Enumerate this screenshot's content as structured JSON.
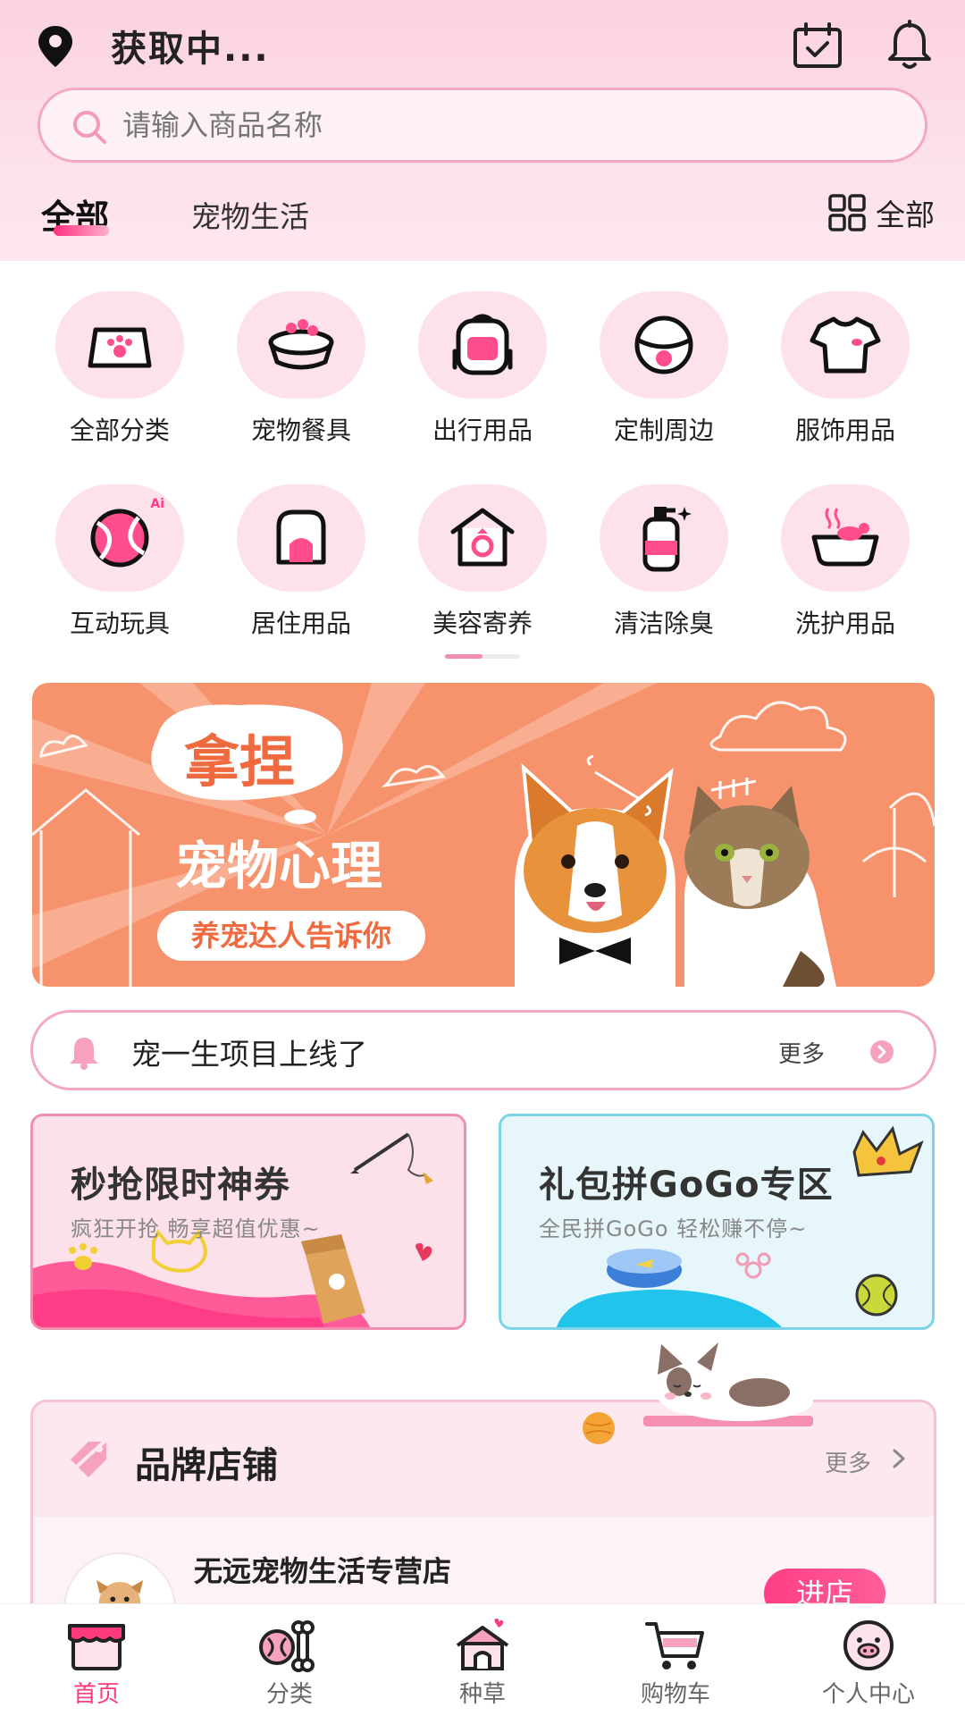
{
  "header": {
    "location": "获取中...",
    "search_placeholder": "请输入商品名称",
    "tabs": [
      "全部",
      "宠物生活"
    ],
    "all_button": "全部"
  },
  "categories": [
    {
      "label": "全部分类",
      "icon": "pet-paw-card-icon"
    },
    {
      "label": "宠物餐具",
      "icon": "pet-bowl-icon"
    },
    {
      "label": "出行用品",
      "icon": "backpack-icon"
    },
    {
      "label": "定制周边",
      "icon": "collar-bell-icon"
    },
    {
      "label": "服饰用品",
      "icon": "tshirt-icon"
    },
    {
      "label": "互动玩具",
      "icon": "ball-toy-icon",
      "badge": "Ai"
    },
    {
      "label": "居住用品",
      "icon": "pet-house-icon"
    },
    {
      "label": "美容寄养",
      "icon": "grooming-house-icon"
    },
    {
      "label": "清洁除臭",
      "icon": "spray-bottle-icon"
    },
    {
      "label": "洗护用品",
      "icon": "bathtub-icon"
    }
  ],
  "banner": {
    "headline": "拿捏",
    "title": "宠物心理",
    "subtitle": "养宠达人告诉你"
  },
  "notice": {
    "text": "宠一生项目上线了",
    "more": "更多"
  },
  "promos": [
    {
      "title": "秒抢限时神券",
      "subtitle": "疯狂开抢  畅享超值优惠~"
    },
    {
      "title": "礼包拼GoGo专区",
      "subtitle": "全民拼GoGo  轻松赚不停~"
    }
  ],
  "brand": {
    "title": "品牌店铺",
    "more": "更多",
    "shop_name": "无远宠物生活专营店",
    "enter": "进店"
  },
  "nav": [
    {
      "label": "首页",
      "active": true
    },
    {
      "label": "分类",
      "active": false
    },
    {
      "label": "种草",
      "active": false
    },
    {
      "label": "购物车",
      "active": false
    },
    {
      "label": "个人中心",
      "active": false
    }
  ],
  "colors": {
    "accent": "#ff3a7c",
    "soft_pink": "#fde2ea",
    "banner_orange": "#f7936c"
  }
}
